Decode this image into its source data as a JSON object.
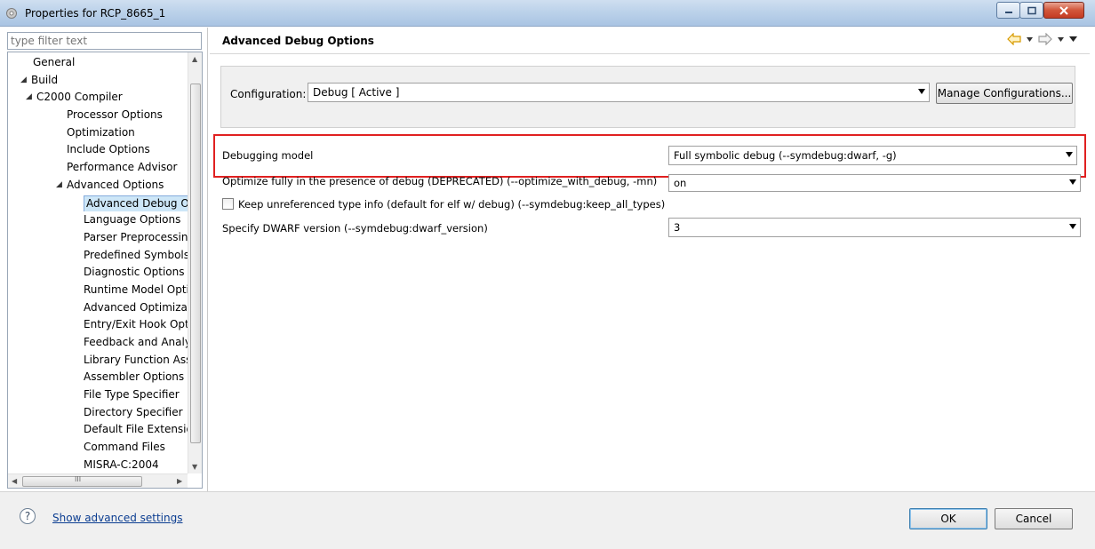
{
  "window": {
    "title": "Properties for RCP_8665_1"
  },
  "filter": {
    "placeholder": "type filter text"
  },
  "tree": {
    "items": [
      {
        "label": "General",
        "level": 0,
        "expander": ""
      },
      {
        "label": "Build",
        "level": 0,
        "expander": "◢"
      },
      {
        "label": "C2000 Compiler",
        "level": 1,
        "expander": "◢"
      },
      {
        "label": "Processor Options",
        "level": 2,
        "expander": ""
      },
      {
        "label": "Optimization",
        "level": 2,
        "expander": ""
      },
      {
        "label": "Include Options",
        "level": 2,
        "expander": ""
      },
      {
        "label": "Performance Advisor",
        "level": 2,
        "expander": ""
      },
      {
        "label": "Advanced Options",
        "level": 2,
        "expander": "◢",
        "expander_level": 1
      },
      {
        "label": "Advanced Debug Op",
        "level": 3,
        "expander": "",
        "selected": true
      },
      {
        "label": "Language Options",
        "level": 3,
        "expander": ""
      },
      {
        "label": "Parser Preprocessin",
        "level": 3,
        "expander": ""
      },
      {
        "label": "Predefined Symbols",
        "level": 3,
        "expander": ""
      },
      {
        "label": "Diagnostic Options",
        "level": 3,
        "expander": ""
      },
      {
        "label": "Runtime Model Opti",
        "level": 3,
        "expander": ""
      },
      {
        "label": "Advanced Optimizat",
        "level": 3,
        "expander": ""
      },
      {
        "label": "Entry/Exit Hook Opti",
        "level": 3,
        "expander": ""
      },
      {
        "label": "Feedback and Analy",
        "level": 3,
        "expander": ""
      },
      {
        "label": "Library Function Ass",
        "level": 3,
        "expander": ""
      },
      {
        "label": "Assembler Options",
        "level": 3,
        "expander": ""
      },
      {
        "label": "File Type Specifier",
        "level": 3,
        "expander": ""
      },
      {
        "label": "Directory Specifier",
        "level": 3,
        "expander": ""
      },
      {
        "label": "Default File Extensio",
        "level": 3,
        "expander": ""
      },
      {
        "label": "Command Files",
        "level": 3,
        "expander": ""
      },
      {
        "label": "MISRA-C:2004",
        "level": 3,
        "expander": ""
      }
    ],
    "hscroll_grip": "III"
  },
  "page": {
    "title": "Advanced Debug Options",
    "config_label": "Configuration:",
    "config_value": "Debug  [ Active ]",
    "manage_button": "Manage Configurations...",
    "options": {
      "debugging_model_label": "Debugging model",
      "debugging_model_value": "Full symbolic debug (--symdebug:dwarf, -g)",
      "optimize_label": "Optimize fully in the presence of debug (DEPRECATED) (--optimize_with_debug, -mn)",
      "optimize_value": "on",
      "keep_types_label": "Keep unreferenced type info (default for elf w/ debug) (--symdebug:keep_all_types)",
      "keep_types_checked": false,
      "dwarf_label": "Specify DWARF version (--symdebug:dwarf_version)",
      "dwarf_value": "3"
    }
  },
  "footer": {
    "help_glyph": "?",
    "advanced_link": "Show advanced settings",
    "ok": "OK",
    "cancel": "Cancel"
  },
  "colors": {
    "highlight": "#e02020",
    "selection": "#cde6f7",
    "link": "#0b3d91",
    "nav_arrow": "#e6a000"
  }
}
